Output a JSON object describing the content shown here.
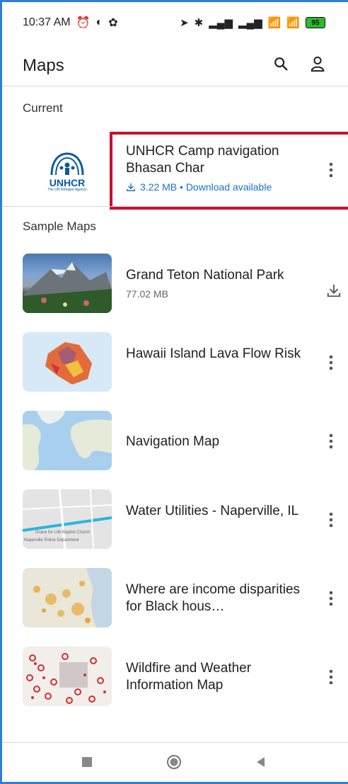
{
  "status_bar": {
    "time": "10:37 AM",
    "battery": "95"
  },
  "app_bar": {
    "title": "Maps"
  },
  "sections": {
    "current": "Current",
    "sample": "Sample Maps"
  },
  "current_map": {
    "title": "UNHCR Camp navigation Bhasan Char",
    "size": "3.22 MB • Download available",
    "logo_text": "UNHCR",
    "logo_subtext": "The UN Refugee Agency"
  },
  "sample_maps": [
    {
      "title": "Grand Teton National Park",
      "subtitle": "77.02 MB",
      "action": "download-icon"
    },
    {
      "title": "Hawaii Island Lava Flow Risk",
      "subtitle": "",
      "action": "more-vert-icon"
    },
    {
      "title": "Navigation Map",
      "subtitle": "",
      "action": "more-vert-icon"
    },
    {
      "title": "Water Utilities - Naperville, IL",
      "subtitle": "",
      "action": "more-vert-icon"
    },
    {
      "title": "Where are income disparities for Black hous…",
      "subtitle": "",
      "action": "more-vert-icon"
    },
    {
      "title": "Wildfire and Weather Information Map",
      "subtitle": "",
      "action": "more-vert-icon"
    }
  ],
  "map_thumb_labels": {
    "water_1": "Grace for Life Baptist Church",
    "water_2": "Naperville Police Department"
  },
  "colors": {
    "accent": "#1a73c8",
    "highlight": "#c8102e",
    "battery": "#2eb82e"
  }
}
